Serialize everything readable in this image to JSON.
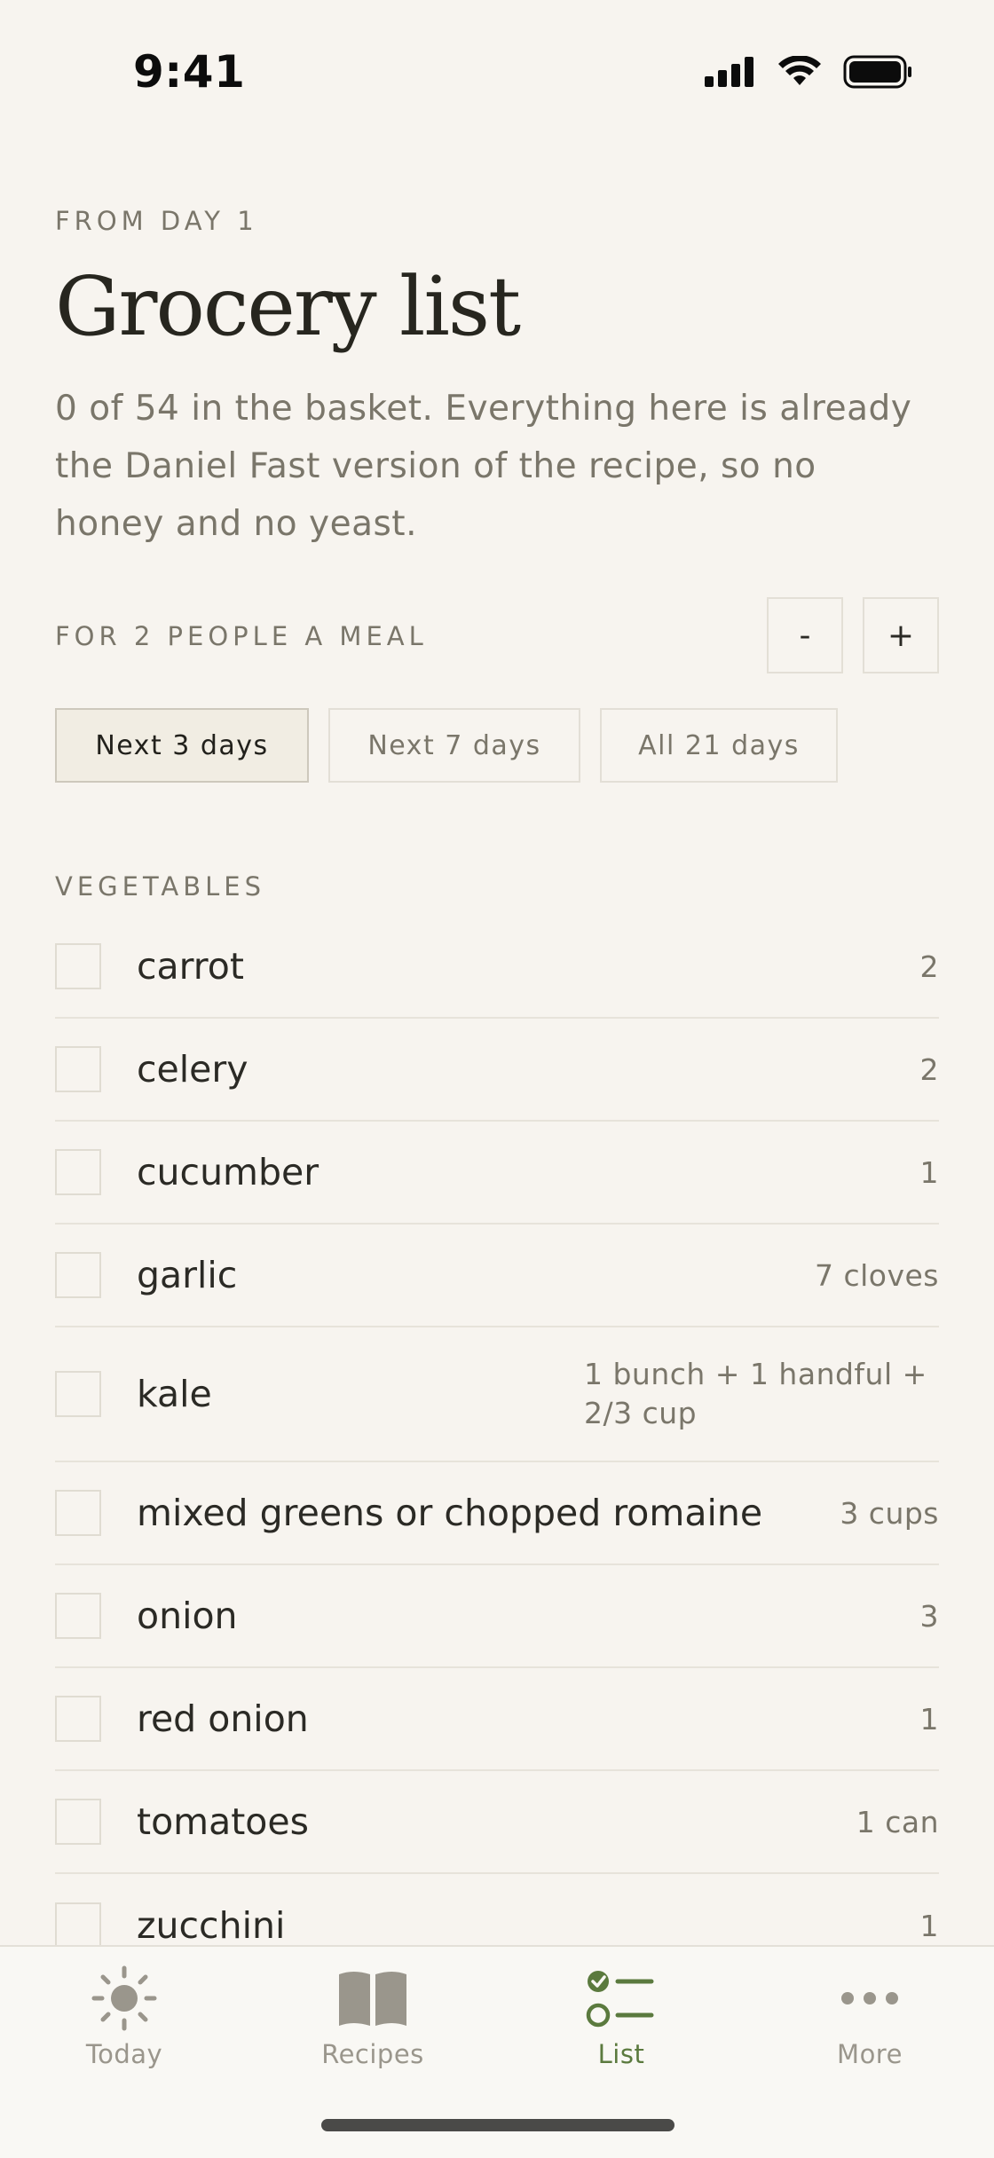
{
  "status_bar": {
    "time": "9:41"
  },
  "header": {
    "eyebrow": "FROM DAY 1",
    "title": "Grocery list",
    "subtitle": "0 of 54 in the basket. Everything here is already the Daniel Fast version of the recipe, so no honey and no yeast."
  },
  "servings": {
    "label": "FOR 2 PEOPLE A MEAL",
    "minus": "-",
    "plus": "+"
  },
  "range_tabs": [
    {
      "label": "Next 3 days",
      "active": true
    },
    {
      "label": "Next 7 days",
      "active": false
    },
    {
      "label": "All 21 days",
      "active": false
    }
  ],
  "section": {
    "label": "VEGETABLES"
  },
  "items": [
    {
      "name": "carrot",
      "qty": "2",
      "checked": false
    },
    {
      "name": "celery",
      "qty": "2",
      "checked": false
    },
    {
      "name": "cucumber",
      "qty": "1",
      "checked": false
    },
    {
      "name": "garlic",
      "qty": "7 cloves",
      "checked": false
    },
    {
      "name": "kale",
      "qty": "1 bunch + 1 handful + 2/3 cup",
      "checked": false
    },
    {
      "name": "mixed greens or chopped romaine",
      "qty": "3 cups",
      "checked": false
    },
    {
      "name": "onion",
      "qty": "3",
      "checked": false
    },
    {
      "name": "red onion",
      "qty": "1",
      "checked": false
    },
    {
      "name": "tomatoes",
      "qty": "1 can",
      "checked": false
    },
    {
      "name": "zucchini",
      "qty": "1",
      "checked": false
    }
  ],
  "tab_bar": [
    {
      "label": "Today",
      "icon": "sun-icon",
      "active": false
    },
    {
      "label": "Recipes",
      "icon": "book-icon",
      "active": false
    },
    {
      "label": "List",
      "icon": "checklist-icon",
      "active": true
    },
    {
      "label": "More",
      "icon": "more-icon",
      "active": false
    }
  ],
  "colors": {
    "accent": "#5b7a3e",
    "background": "#f7f4ef",
    "muted": "#7a766a"
  }
}
